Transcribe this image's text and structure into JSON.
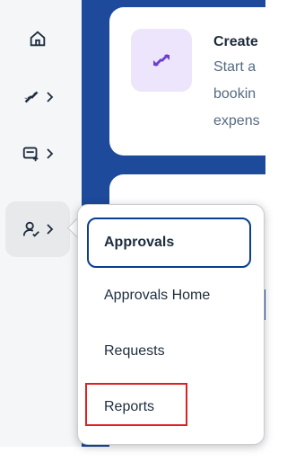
{
  "card": {
    "title": "Create",
    "lines": [
      "Start a",
      "bookin",
      "expens"
    ]
  },
  "menu": {
    "header": "Approvals",
    "items": [
      "Approvals Home",
      "Requests",
      "Reports"
    ],
    "highlighted": "Reports"
  },
  "colors": {
    "main_blue": "#1e4a9c",
    "highlight": "#e02020",
    "accent_purple": "#ece5fb"
  }
}
